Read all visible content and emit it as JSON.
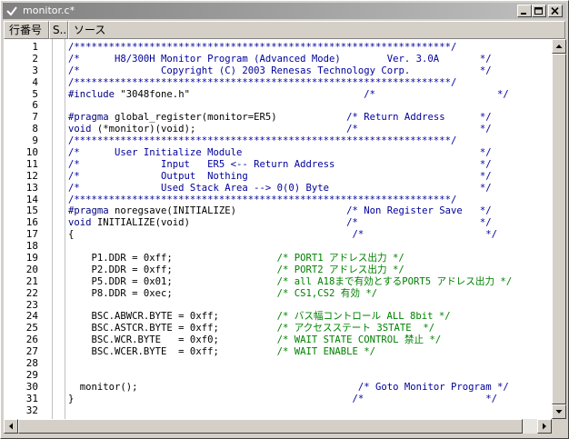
{
  "window": {
    "title": "monitor.c*"
  },
  "header": {
    "columns": [
      "行番号",
      "S..",
      "ソース"
    ]
  },
  "colors": {
    "comment": "#00009c",
    "directive": "#000080",
    "green": "#008000",
    "text": "#000000"
  },
  "lines": [
    {
      "n": "1",
      "segs": [
        {
          "t": "/*****************************************************************/",
          "c": "comment"
        }
      ]
    },
    {
      "n": "2",
      "segs": [
        {
          "t": "/*      H8/300H Monitor Program (Advanced Mode)        Ver. 3.0A       */",
          "c": "comment"
        }
      ]
    },
    {
      "n": "3",
      "segs": [
        {
          "t": "/*              Copyright (C) 2003 Renesas Technology Corp.            */",
          "c": "comment"
        }
      ]
    },
    {
      "n": "4",
      "segs": [
        {
          "t": "/*****************************************************************/",
          "c": "comment"
        }
      ]
    },
    {
      "n": "5",
      "segs": [
        {
          "t": "#include",
          "c": "directive"
        },
        {
          "t": " \"3048fone.h\"                              ",
          "c": "text"
        },
        {
          "t": "/*                     */",
          "c": "comment"
        }
      ]
    },
    {
      "n": "6",
      "segs": []
    },
    {
      "n": "7",
      "segs": [
        {
          "t": "#pragma",
          "c": "directive"
        },
        {
          "t": " global_register(monitor=ER5)            ",
          "c": "text"
        },
        {
          "t": "/* Return Address      */",
          "c": "comment"
        }
      ]
    },
    {
      "n": "8",
      "segs": [
        {
          "t": "void",
          "c": "directive"
        },
        {
          "t": " (*monitor)(void);                          ",
          "c": "text"
        },
        {
          "t": "/*                     */",
          "c": "comment"
        }
      ]
    },
    {
      "n": "9",
      "segs": [
        {
          "t": "/*****************************************************************/",
          "c": "comment"
        }
      ]
    },
    {
      "n": "10",
      "segs": [
        {
          "t": "/*      User Initialize Module                                         */",
          "c": "comment"
        }
      ]
    },
    {
      "n": "11",
      "segs": [
        {
          "t": "/*              Input   ER5 <-- Return Address                         */",
          "c": "comment"
        }
      ]
    },
    {
      "n": "12",
      "segs": [
        {
          "t": "/*              Output  Nothing                                        */",
          "c": "comment"
        }
      ]
    },
    {
      "n": "13",
      "segs": [
        {
          "t": "/*              Used Stack Area --> 0(0) Byte                          */",
          "c": "comment"
        }
      ]
    },
    {
      "n": "14",
      "segs": [
        {
          "t": "/*****************************************************************/",
          "c": "comment"
        }
      ]
    },
    {
      "n": "15",
      "segs": [
        {
          "t": "#pragma",
          "c": "directive"
        },
        {
          "t": " noregsave(INITIALIZE)                   ",
          "c": "text"
        },
        {
          "t": "/* Non Register Save   */",
          "c": "comment"
        }
      ]
    },
    {
      "n": "16",
      "segs": [
        {
          "t": "void",
          "c": "directive"
        },
        {
          "t": " INITIALIZE(void)                           ",
          "c": "text"
        },
        {
          "t": "/*                     */",
          "c": "comment"
        }
      ]
    },
    {
      "n": "17",
      "segs": [
        {
          "t": "{                                                ",
          "c": "text"
        },
        {
          "t": "/*                     */",
          "c": "comment"
        }
      ]
    },
    {
      "n": "18",
      "segs": []
    },
    {
      "n": "19",
      "segs": [
        {
          "t": "    P1.DDR = 0xff;                  ",
          "c": "text"
        },
        {
          "t": "/* PORT1 アドレス出力 */",
          "c": "green"
        }
      ]
    },
    {
      "n": "20",
      "segs": [
        {
          "t": "    P2.DDR = 0xff;                  ",
          "c": "text"
        },
        {
          "t": "/* PORT2 アドレス出力 */",
          "c": "green"
        }
      ]
    },
    {
      "n": "21",
      "segs": [
        {
          "t": "    P5.DDR = 0x01;                  ",
          "c": "text"
        },
        {
          "t": "/* all A18まで有効とするPORT5 アドレス出力 */",
          "c": "green"
        }
      ]
    },
    {
      "n": "22",
      "segs": [
        {
          "t": "    P8.DDR = 0xec;                  ",
          "c": "text"
        },
        {
          "t": "/* CS1,CS2 有効 */",
          "c": "green"
        }
      ]
    },
    {
      "n": "23",
      "segs": []
    },
    {
      "n": "24",
      "segs": [
        {
          "t": "    BSC.ABWCR.BYTE = 0xff;          ",
          "c": "text"
        },
        {
          "t": "/* バス幅コントロール ALL 8bit */",
          "c": "green"
        }
      ]
    },
    {
      "n": "25",
      "segs": [
        {
          "t": "    BSC.ASTCR.BYTE = 0xff;          ",
          "c": "text"
        },
        {
          "t": "/* アクセスステート 3STATE  */",
          "c": "green"
        }
      ]
    },
    {
      "n": "26",
      "segs": [
        {
          "t": "    BSC.WCR.BYTE   = 0xf0;          ",
          "c": "text"
        },
        {
          "t": "/* WAIT STATE CONTROL 禁止 */",
          "c": "green"
        }
      ]
    },
    {
      "n": "27",
      "segs": [
        {
          "t": "    BSC.WCER.BYTE  = 0xff;          ",
          "c": "text"
        },
        {
          "t": "/* WAIT ENABLE */",
          "c": "green"
        }
      ]
    },
    {
      "n": "28",
      "segs": []
    },
    {
      "n": "29",
      "segs": []
    },
    {
      "n": "30",
      "segs": [
        {
          "t": "  monitor();                                      ",
          "c": "text"
        },
        {
          "t": "/* Goto Monitor Program */",
          "c": "comment"
        }
      ]
    },
    {
      "n": "31",
      "segs": [
        {
          "t": "}                                                ",
          "c": "text"
        },
        {
          "t": "/*                     */",
          "c": "comment"
        }
      ]
    },
    {
      "n": "32",
      "segs": []
    }
  ]
}
